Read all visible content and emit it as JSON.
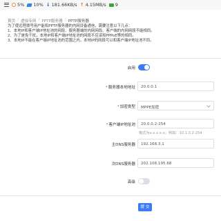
{
  "status_bar": {
    "cpu": "5%",
    "memory": "10%",
    "download": "181.66KB/s",
    "upload": "4.15MB/s",
    "users": "9"
  },
  "breadcrumb": [
    "首页",
    "虚拟专网",
    "PPTP服务器",
    "PPTP服务器"
  ],
  "notice": {
    "intro": "为了使远程拨号用户能和PPTP服务器的内网设备通信，需要注意以下几点：",
    "items": [
      "1、本地IP和客户端IP地址池的网段、服务器端的内网网段、客户端的内网网段不能相同。",
      "2、为了是免干扰，本地IP和客户端IP地址池的网段不应该和PPPoE等的相同。",
      "3、本地IP不能在客户端IP地址池的范围之内，本地IP的网段可以和客户端IP地址池不同。"
    ]
  },
  "form": {
    "enable": {
      "label": "启用",
      "on": true
    },
    "server_local_address": {
      "label": "服务器本地地址",
      "value": "20.0.0.1"
    },
    "encryption_type": {
      "label": "加密类型",
      "value": "MPPE加密"
    },
    "client_ip_pool": {
      "label": "客户端IP地址池",
      "value": "20.0.0.2-254",
      "hint": "格式为x.x.x.x-x，例如：10.1.0.2-254"
    },
    "primary_dns": {
      "label": "主DNS服务器",
      "value": "192.168.3.1"
    },
    "secondary_dns": {
      "label": "次DNS服务器",
      "value": "202.106.195.68"
    },
    "advanced": {
      "label": "高级",
      "on": false
    },
    "submit_label": "提 交"
  },
  "colors": {
    "accent": "#3b7cf5",
    "required": "#e53935"
  }
}
